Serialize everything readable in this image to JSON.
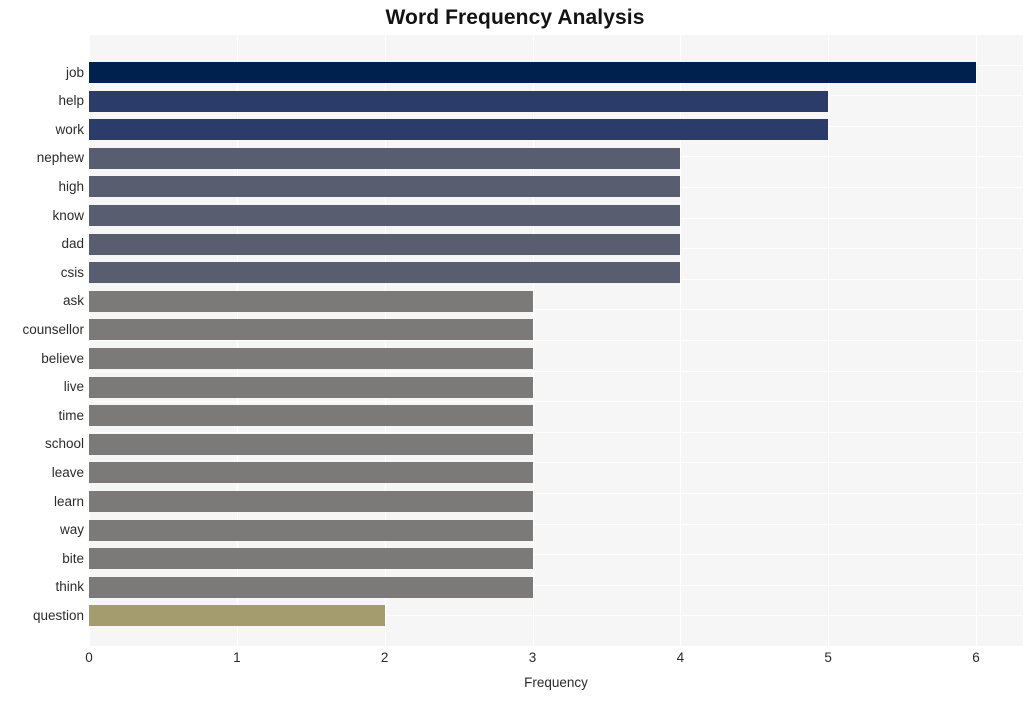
{
  "chart_data": {
    "type": "bar",
    "orientation": "horizontal",
    "title": "Word Frequency Analysis",
    "xlabel": "Frequency",
    "ylabel": "",
    "xlim": [
      0,
      6
    ],
    "xticks": [
      0,
      1,
      2,
      3,
      4,
      5,
      6
    ],
    "xtick_labels": [
      "0",
      "1",
      "2",
      "3",
      "4",
      "5",
      "6"
    ],
    "grid": true,
    "legend": "none",
    "categories": [
      "job",
      "help",
      "work",
      "nephew",
      "high",
      "know",
      "dad",
      "csis",
      "ask",
      "counsellor",
      "believe",
      "live",
      "time",
      "school",
      "leave",
      "learn",
      "way",
      "bite",
      "think",
      "question"
    ],
    "values": [
      6,
      5,
      5,
      4,
      4,
      4,
      4,
      4,
      3,
      3,
      3,
      3,
      3,
      3,
      3,
      3,
      3,
      3,
      3,
      2
    ],
    "bar_colors": [
      "#00204d",
      "#2b3c6b",
      "#2b3c6b",
      "#585e70",
      "#585e70",
      "#585e70",
      "#585e70",
      "#585e70",
      "#7b7a78",
      "#7b7a78",
      "#7b7a78",
      "#7b7a78",
      "#7b7a78",
      "#7b7a78",
      "#7b7a78",
      "#7b7a78",
      "#7b7a78",
      "#7b7a78",
      "#7b7a78",
      "#a49b6f"
    ],
    "plot_background": "#f6f6f6",
    "gridline_color": "#ffffff",
    "figure_background": "#ffffff",
    "title_color": "#131313",
    "tick_color": "#2b2b2b"
  }
}
